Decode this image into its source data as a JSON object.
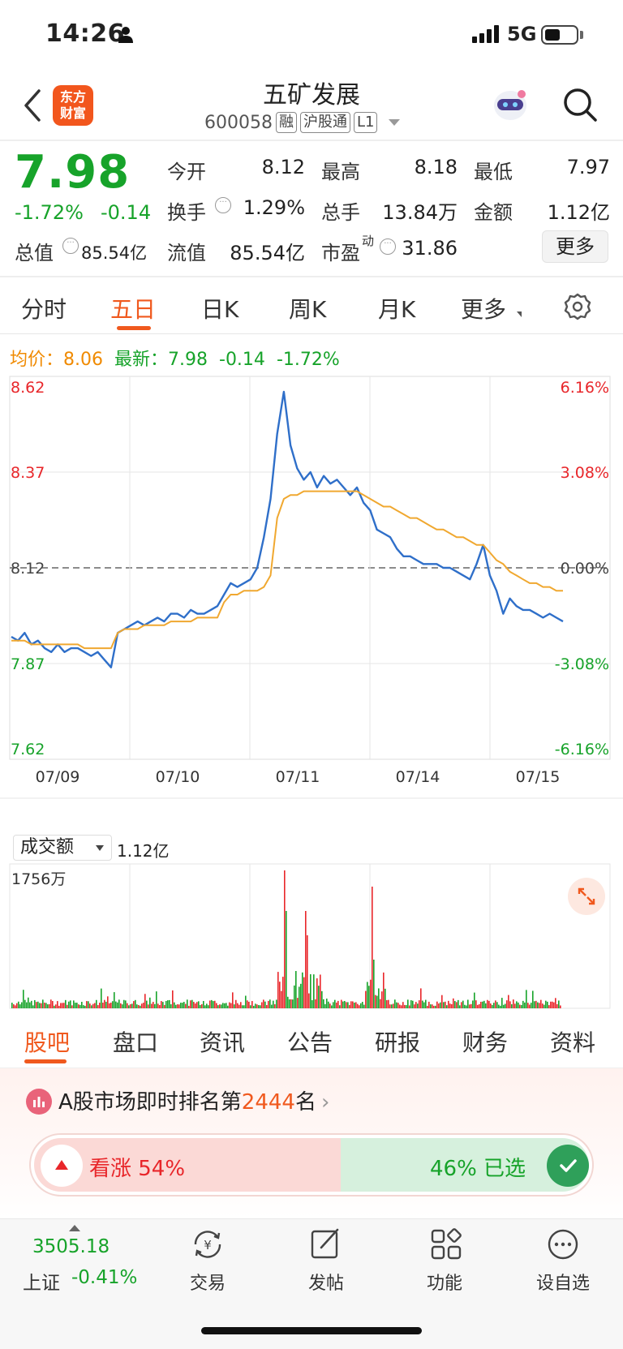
{
  "status_bar": {
    "time": "14:26",
    "network": "5G"
  },
  "header": {
    "logo_line1": "东方",
    "logo_line2": "财富",
    "stock_name": "五矿发展",
    "stock_code": "600058",
    "tags": [
      "融",
      "沪股通",
      "L1"
    ]
  },
  "quote": {
    "price": "7.98",
    "change_pct": "-1.72%",
    "change_abs": "-0.14",
    "fields": [
      {
        "label": "今开",
        "value": "8.12",
        "color": "normal"
      },
      {
        "label": "最高",
        "value": "8.18",
        "color": "red"
      },
      {
        "label": "最低",
        "value": "7.97",
        "color": "green"
      },
      {
        "label": "换手",
        "value": "1.29%",
        "color": "normal"
      },
      {
        "label": "总手",
        "value": "13.84万",
        "color": "normal"
      },
      {
        "label": "金额",
        "value": "1.12亿",
        "color": "normal"
      },
      {
        "label": "总值",
        "value": "85.54亿",
        "color": "normal"
      },
      {
        "label": "流值",
        "value": "85.54亿",
        "color": "normal"
      },
      {
        "label": "市盈",
        "value": "31.86",
        "color": "normal"
      }
    ],
    "pe_superscript": "动",
    "more_label": "更多"
  },
  "period_tabs": [
    "分时",
    "五日",
    "日K",
    "周K",
    "月K",
    "更多"
  ],
  "active_period": "五日",
  "info_line": {
    "avg_label": "均价：",
    "avg_value": "8.06",
    "latest_label": "最新：",
    "latest_value": "7.98",
    "latest_change": "-0.14",
    "latest_pct": "-1.72%"
  },
  "chart_data": {
    "type": "line",
    "y_ticks_left": [
      "8.62",
      "8.37",
      "8.12",
      "7.87",
      "7.62"
    ],
    "y_ticks_right": [
      "6.16%",
      "3.08%",
      "0.00%",
      "-3.08%",
      "-6.16%"
    ],
    "ylim": [
      7.62,
      8.62
    ],
    "prev_close": 8.12,
    "x_ticks": [
      "07/09",
      "07/10",
      "07/11",
      "07/14",
      "07/15"
    ],
    "series": [
      {
        "color": "#2f6fc9",
        "values": [
          7.94,
          7.93,
          7.95,
          7.92,
          7.93,
          7.91,
          7.9,
          7.92,
          7.9,
          7.91,
          7.91,
          7.9,
          7.89,
          7.9,
          7.88,
          7.86,
          7.95,
          7.96,
          7.97,
          7.98,
          7.97,
          7.98,
          7.99,
          7.98,
          8.0,
          8.0,
          7.99,
          8.01,
          8.0,
          8.0,
          8.01,
          8.02,
          8.05,
          8.08,
          8.07,
          8.08,
          8.09,
          8.12,
          8.2,
          8.3,
          8.47,
          8.58,
          8.44,
          8.38,
          8.35,
          8.37,
          8.33,
          8.36,
          8.34,
          8.35,
          8.33,
          8.31,
          8.33,
          8.29,
          8.27,
          8.22,
          8.21,
          8.2,
          8.17,
          8.15,
          8.15,
          8.14,
          8.13,
          8.13,
          8.13,
          8.12,
          8.12,
          8.11,
          8.1,
          8.09,
          8.13,
          8.18,
          8.1,
          8.06,
          8.0,
          8.04,
          8.02,
          8.01,
          8.01,
          8.0,
          7.99,
          8.0,
          7.99,
          7.98
        ]
      },
      {
        "color": "#f0a830",
        "values": [
          7.93,
          7.93,
          7.93,
          7.92,
          7.92,
          7.92,
          7.92,
          7.92,
          7.92,
          7.92,
          7.92,
          7.91,
          7.91,
          7.91,
          7.91,
          7.91,
          7.95,
          7.96,
          7.96,
          7.96,
          7.97,
          7.97,
          7.97,
          7.97,
          7.98,
          7.98,
          7.98,
          7.98,
          7.99,
          7.99,
          7.99,
          7.99,
          8.03,
          8.05,
          8.05,
          8.06,
          8.06,
          8.06,
          8.07,
          8.1,
          8.25,
          8.3,
          8.31,
          8.31,
          8.32,
          8.32,
          8.32,
          8.32,
          8.32,
          8.32,
          8.32,
          8.32,
          8.32,
          8.31,
          8.3,
          8.29,
          8.28,
          8.28,
          8.27,
          8.26,
          8.25,
          8.25,
          8.24,
          8.23,
          8.22,
          8.22,
          8.21,
          8.2,
          8.2,
          8.19,
          8.18,
          8.18,
          8.16,
          8.14,
          8.13,
          8.11,
          8.1,
          8.09,
          8.08,
          8.08,
          8.07,
          8.07,
          8.06,
          8.06
        ]
      }
    ]
  },
  "volume": {
    "selector_label": "成交额",
    "total": "1.12亿",
    "max_label": "1756万"
  },
  "bottom_tabs": [
    "股吧",
    "盘口",
    "资讯",
    "公告",
    "研报",
    "财务",
    "资料"
  ],
  "active_bottom_tab": "股吧",
  "ranking": {
    "prefix": "A股市场即时排名第",
    "rank": "2444",
    "suffix": "名",
    "vote_up_label": "看涨 54%",
    "vote_down_label": "46% 已选",
    "vote_up_fraction": 0.54
  },
  "nav": {
    "index_value": "3505.18",
    "index_name": "上证",
    "index_change": "-0.41%",
    "items": [
      "交易",
      "发帖",
      "功能",
      "设自选"
    ]
  }
}
